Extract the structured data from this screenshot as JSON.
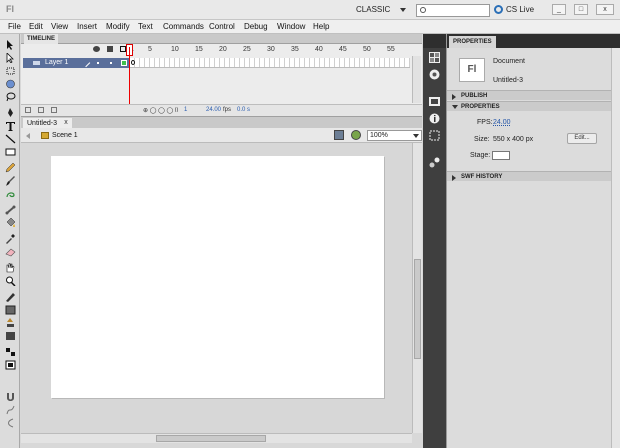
{
  "titlebar": {
    "app_logo": "Fl",
    "workspace": "CLASSIC",
    "search_placeholder": "",
    "cs_live": "CS Live",
    "win_buttons": [
      "_",
      "□",
      "x"
    ]
  },
  "menu": [
    "File",
    "Edit",
    "View",
    "Insert",
    "Modify",
    "Text",
    "Commands",
    "Control",
    "Debug",
    "Window",
    "Help"
  ],
  "timeline": {
    "tab": "TIMELINE",
    "layer_name": "Layer 1",
    "frame_numbers": [
      "1",
      "5",
      "10",
      "15",
      "20",
      "25",
      "30",
      "35",
      "40",
      "45",
      "50",
      "55"
    ],
    "current_frame": "1",
    "fps": "24.00",
    "fps_unit": "fps",
    "elapsed": "0.0 s"
  },
  "document": {
    "tab": "Untitled-3",
    "close": "x",
    "scene": "Scene 1",
    "zoom": "100%"
  },
  "properties": {
    "tab": "PROPERTIES",
    "icon_text": "Fl",
    "type": "Document",
    "name": "Untitled-3",
    "sections": {
      "publish": "PUBLISH",
      "properties": "PROPERTIES",
      "swf_history": "SWF HISTORY"
    },
    "fps_label": "FPS:",
    "fps_value": "24.00",
    "size_label": "Size:",
    "size_value": "550 x 400 px",
    "edit_button": "Edit...",
    "stage_label": "Stage:",
    "stage_color": "#ffffff"
  },
  "colors": {
    "accent": "#2a6fb7",
    "layer_highlight": "#5a6f9b",
    "playhead": "#dd0000",
    "panel_dark": "#3f3f3f"
  }
}
